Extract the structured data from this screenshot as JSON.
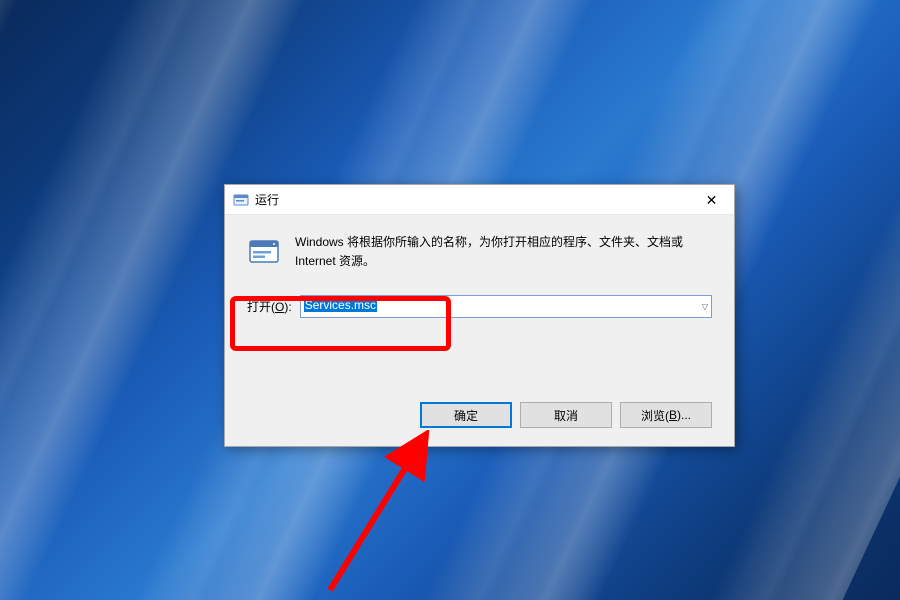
{
  "dialog": {
    "title": "运行",
    "description": "Windows 将根据你所输入的名称，为你打开相应的程序、文件夹、文档或 Internet 资源。",
    "open_label_prefix": "打开(",
    "open_label_key": "O",
    "open_label_suffix": "):",
    "input_value": "Services.msc",
    "buttons": {
      "ok": "确定",
      "cancel": "取消",
      "browse_prefix": "浏览(",
      "browse_key": "B",
      "browse_suffix": ")..."
    }
  }
}
